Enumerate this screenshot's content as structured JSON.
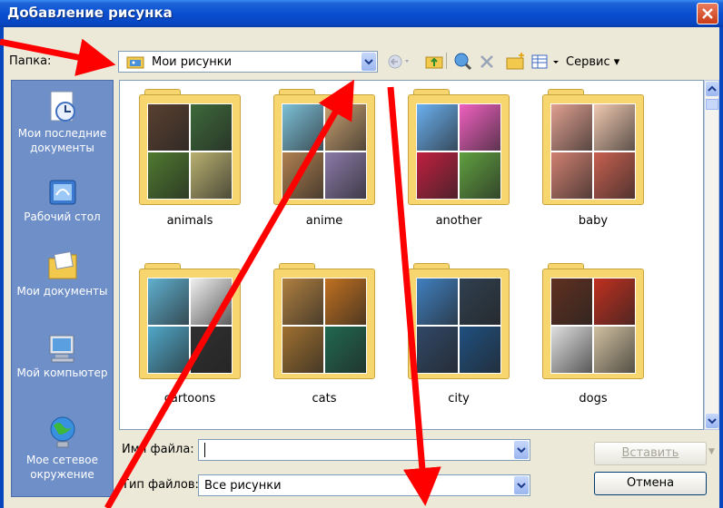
{
  "window": {
    "title": "Добавление рисунка"
  },
  "lookin": {
    "label": "Папка:",
    "value": "Мои рисунки"
  },
  "toolbar": {
    "tools_label": "Сервис"
  },
  "places": [
    {
      "label": "Мои последние документы"
    },
    {
      "label": "Рабочий стол"
    },
    {
      "label": "Мои документы"
    },
    {
      "label": "Мой компьютер"
    },
    {
      "label": "Мое сетевое окружение"
    }
  ],
  "folders": [
    {
      "name": "animals",
      "colors": [
        "#5a4030",
        "#3d6a3a",
        "#4f7a2f",
        "#b8b070"
      ]
    },
    {
      "name": "anime",
      "colors": [
        "#7cc0d8",
        "#c8a070",
        "#b08050",
        "#8a7aa8"
      ]
    },
    {
      "name": "another",
      "colors": [
        "#6ab0f0",
        "#f060c0",
        "#c02040",
        "#60a040"
      ]
    },
    {
      "name": "baby",
      "colors": [
        "#e0a090",
        "#f0c8b0",
        "#d08070",
        "#c86050"
      ]
    },
    {
      "name": "cartoons",
      "colors": [
        "#60b0d0",
        "#f0f0f0",
        "#50a8c8",
        "#303030"
      ]
    },
    {
      "name": "cats",
      "colors": [
        "#b08040",
        "#c07020",
        "#a07030",
        "#206850"
      ]
    },
    {
      "name": "city",
      "colors": [
        "#4080c0",
        "#304050",
        "#304868",
        "#205080"
      ]
    },
    {
      "name": "dogs",
      "colors": [
        "#603020",
        "#c03020",
        "#e0e0e0",
        "#d0c0a0"
      ]
    }
  ],
  "filename": {
    "label": "Имя файла:",
    "value": ""
  },
  "filetype": {
    "label": "Тип файлов:",
    "value": "Все рисунки"
  },
  "buttons": {
    "insert": "Вставить",
    "cancel": "Отмена"
  },
  "colors": {
    "title_bar": "#0a4fd0",
    "places_bar": "#6f8fc8",
    "folder": "#f7d670",
    "annotation_arrow": "#ff0000"
  }
}
